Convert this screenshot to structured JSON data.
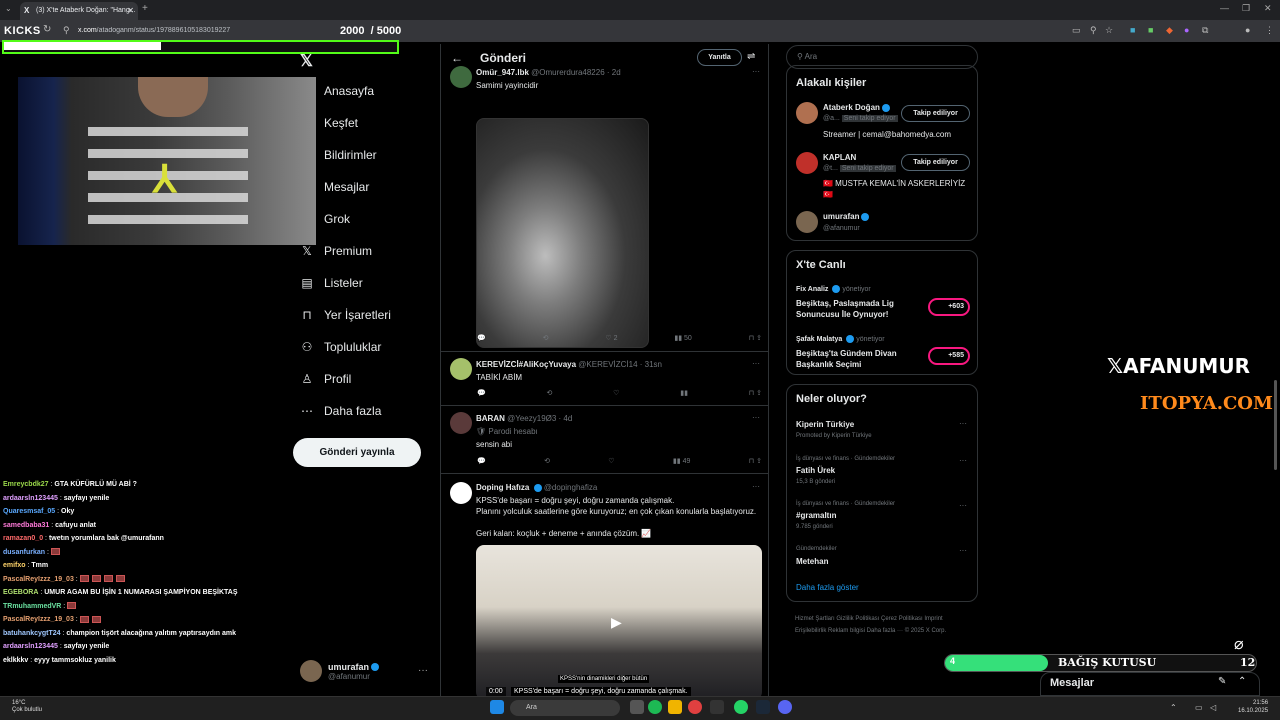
{
  "browser": {
    "tab_title": "(3) X'te Ataberk Doğan: \"Hang...",
    "url_domain": "x.com",
    "url_path": "/atadoganm/status/1978896105183019227"
  },
  "stream": {
    "brand": "KICKS",
    "goal_current": "2000",
    "goal_total": "/ 5000",
    "goal_fraction": 0.4
  },
  "x_nav": {
    "items": [
      {
        "label": "Anasayfa",
        "icon": "home-icon"
      },
      {
        "label": "Keşfet",
        "icon": "search-icon"
      },
      {
        "label": "Bildirimler",
        "icon": "bell-icon"
      },
      {
        "label": "Mesajlar",
        "icon": "mail-icon"
      },
      {
        "label": "Grok",
        "icon": "grok-icon"
      },
      {
        "label": "Premium",
        "icon": "x-icon"
      },
      {
        "label": "Listeler",
        "icon": "list-icon"
      },
      {
        "label": "Yer İşaretleri",
        "icon": "bookmark-icon"
      },
      {
        "label": "Topluluklar",
        "icon": "people-icon"
      },
      {
        "label": "Profil",
        "icon": "user-icon"
      },
      {
        "label": "Daha fazla",
        "icon": "more-icon"
      }
    ],
    "post_button": "Gönderi yayınla",
    "account_name": "umurafan",
    "account_handle": "@afanumur"
  },
  "chat": [
    {
      "user": "Emreycbdk27",
      "color": "#9ad84a",
      "msg": "GTA KÜFÜRLÜ MÜ ABİ ?"
    },
    {
      "user": "ardaarsln123445",
      "color": "#e0a0ff",
      "msg": "sayfayı yenile"
    },
    {
      "user": "Quaresmsaf_05",
      "color": "#5aa9ff",
      "msg": "Oky"
    },
    {
      "user": "samedbaba31",
      "color": "#ff7ad9",
      "msg": "cafuyu anlat"
    },
    {
      "user": "ramazan0_0",
      "color": "#ff6a6a",
      "msg": "twetın yorumlara bak @umurafann"
    },
    {
      "user": "dusanfurkan",
      "color": "#7ab0ff",
      "msg": "",
      "emotes": 1
    },
    {
      "user": "emifxo",
      "color": "#ffd36a",
      "msg": "Tmm"
    },
    {
      "user": "PascalReyIzzz_19_03",
      "color": "#e6a070",
      "msg": "",
      "emotes": 4
    },
    {
      "user": "EGEBORA",
      "color": "#b0e070",
      "msg": "UMUR AGAM BU İŞİN 1 NUMARASI ŞAMPİYON BEŞİKTAŞ"
    },
    {
      "user": "TRmuhammedVR",
      "color": "#6ae0a0",
      "msg": "",
      "emotes": 1
    },
    {
      "user": "PascalReyIzzz_19_03",
      "color": "#e6a070",
      "msg": "",
      "emotes": 2
    },
    {
      "user": "batuhankcygtT24",
      "color": "#a0c8ff",
      "msg": "champion tişört alacağına yalıtım yaptırsaydın amk"
    },
    {
      "user": "ardaarsln123445",
      "color": "#e0a0ff",
      "msg": "sayfayı yenile"
    },
    {
      "user": "eklkkkv",
      "color": "#ffffff",
      "msg": "eyyy tammsokluz yanilik"
    }
  ],
  "post_view": {
    "title": "Gönderi",
    "reply_button": "Yanıtla"
  },
  "tweets": [
    {
      "name": "Omür_947.lbk",
      "handle": "@Omurerdura48226 · 2d",
      "text": "Samimi yayincidir",
      "replies": "",
      "retweets": "",
      "likes": "2",
      "views": "50"
    },
    {
      "name": "KEREVİZCİ#AliKoçYuvaya",
      "handle": "@KEREVİZCİ14 · 31sn",
      "text": "TABİKİ ABİM",
      "replies": "",
      "retweets": "",
      "likes": "",
      "views": ""
    },
    {
      "name": "BARAN",
      "handle": "@Yeezy19Ø3 · 4d",
      "badge": "Parodi hesabı",
      "text": "sensin abi",
      "replies": "",
      "retweets": "",
      "likes": "",
      "views": "49"
    },
    {
      "name": "Doping Hafıza",
      "handle": "@dopinghafiza",
      "text_lines": [
        "KPSS'de başarı = doğru şeyi, doğru zamanda çalışmak.",
        "Planını yolculuk saatlerine göre kuruyoruz; en çok çıkan konularla başlatıyoruz.",
        "Geri kalan: koçluk + deneme + anında çözüm. 📈"
      ],
      "video_caption": "KPSS'nin dinamikleri diğer bütün",
      "video_time": "0:00",
      "video_subtitle": "KPSS'de başarı = doğru şeyi, doğru zamanda çalışmak."
    }
  ],
  "right": {
    "search_placeholder": "Ara",
    "people_title": "Alakalı kişiler",
    "people": [
      {
        "name": "Ataberk Doğan",
        "handle": "@a...",
        "sub": "Seni takip ediyor",
        "bio": "Streamer | cemal@bahomedya.com",
        "button": "Takip ediliyor"
      },
      {
        "name": "KAPLAN",
        "handle": "@t...",
        "sub": "Seni takip ediyor",
        "bio": "🇹🇷 MUSTFA KEMAL'İN ASKERLERİYİZ 🇹🇷",
        "button": "Takip ediliyor"
      },
      {
        "name": "umurafan",
        "handle": "@afanumur",
        "bio": "",
        "button": ""
      }
    ],
    "live_title": "X'te Canlı",
    "live": [
      {
        "host": "Fix Analiz",
        "role": "yönetiyor",
        "title": "Beşiktaş, Paslaşmada Lig Sonuncusu İle Oynuyor!",
        "count": "+603"
      },
      {
        "host": "Şafak Malatya",
        "role": "yönetiyor",
        "title": "Beşiktaş'ta Gündem Divan Başkanlık  Seçimi",
        "count": "+585"
      }
    ],
    "trends_title": "Neler oluyor?",
    "trends": [
      {
        "sub": "",
        "name": "Kiperin Türkiye",
        "meta": "Promoted by Kiperin Türkiye"
      },
      {
        "sub": "İş dünyası ve finans · Gündemdekiler",
        "name": "Fatih Ürek",
        "meta": "15,3 B gönderi"
      },
      {
        "sub": "İş dünyası ve finans · Gündemdekiler",
        "name": "#gramaltın",
        "meta": "9.785 gönderi"
      },
      {
        "sub": "Gündemdekiler",
        "name": "Metehan",
        "meta": ""
      }
    ],
    "show_more": "Daha fazla göster",
    "footer": "Hizmet Şartları  Gizlilik Politikası  Çerez Politikası  Imprint  Erişilebilirlik  Reklam bilgisi  Daha fazla ···  © 2025 X Corp."
  },
  "overlay": {
    "brand": "AFANUMUR",
    "sponsor": "ITOPYA.COM",
    "donation_label": "BAĞIŞ KUTUSU",
    "donation_current": "4",
    "donation_total": "12",
    "donation_fraction": 0.33,
    "messages_bar": "Mesajlar"
  },
  "taskbar": {
    "weather_temp": "16°C",
    "weather_desc": "Çok bulutlu",
    "search": "Ara",
    "time": "21:56",
    "date": "16.10.2025"
  },
  "colors": {
    "accent": "#1d9bf0",
    "kick_green": "#53fc18",
    "live_pink": "#f91880"
  }
}
